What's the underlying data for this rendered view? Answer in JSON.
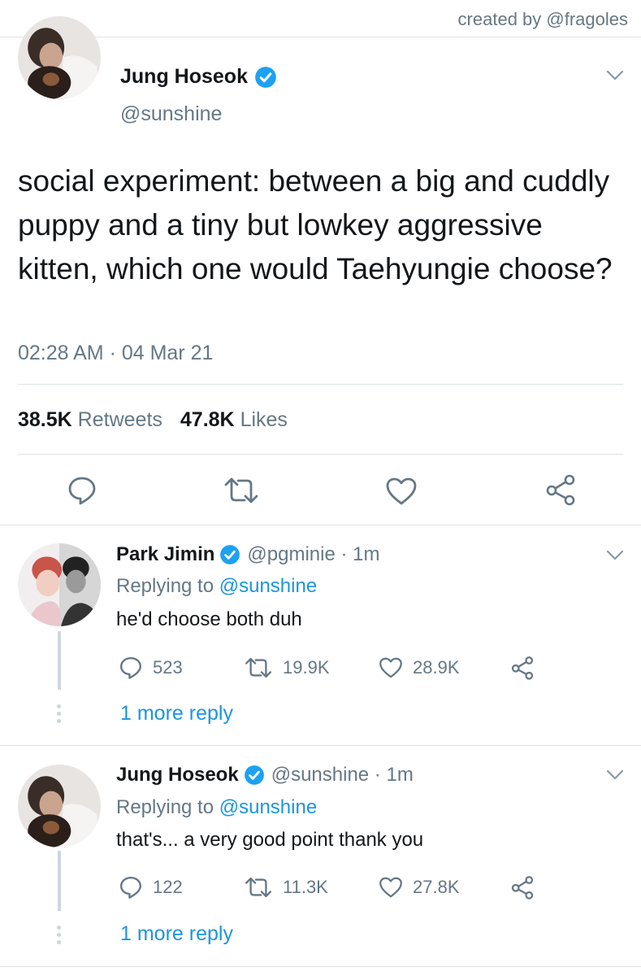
{
  "credit": "created by @fragoles",
  "main_tweet": {
    "name": "Jung Hoseok",
    "handle": "@sunshine",
    "text": "social experiment: between a big and cuddly puppy and a tiny but lowkey aggressive kitten, which one would Taehyungie choose?",
    "timestamp": "02:28 AM · 04 Mar 21",
    "retweets_count": "38.5K",
    "retweets_label": "Retweets",
    "likes_count": "47.8K",
    "likes_label": "Likes"
  },
  "replies": [
    {
      "name": "Park Jimin",
      "handle_time": "@pgminie · 1m",
      "replying_prefix": "Replying to",
      "replying_to": "@sunshine",
      "text": "he'd choose both duh",
      "replies": "523",
      "retweets": "19.9K",
      "likes": "28.9K",
      "more": "1 more reply"
    },
    {
      "name": "Jung Hoseok",
      "handle_time": "@sunshine · 1m",
      "replying_prefix": "Replying to",
      "replying_to": "@sunshine",
      "text": "that's... a very good point thank you",
      "replies": "122",
      "retweets": "11.3K",
      "likes": "27.8K",
      "more": "1 more reply"
    }
  ],
  "colors": {
    "accent": "#1b95e0",
    "muted": "#657786",
    "verified": "#1da1f2"
  }
}
